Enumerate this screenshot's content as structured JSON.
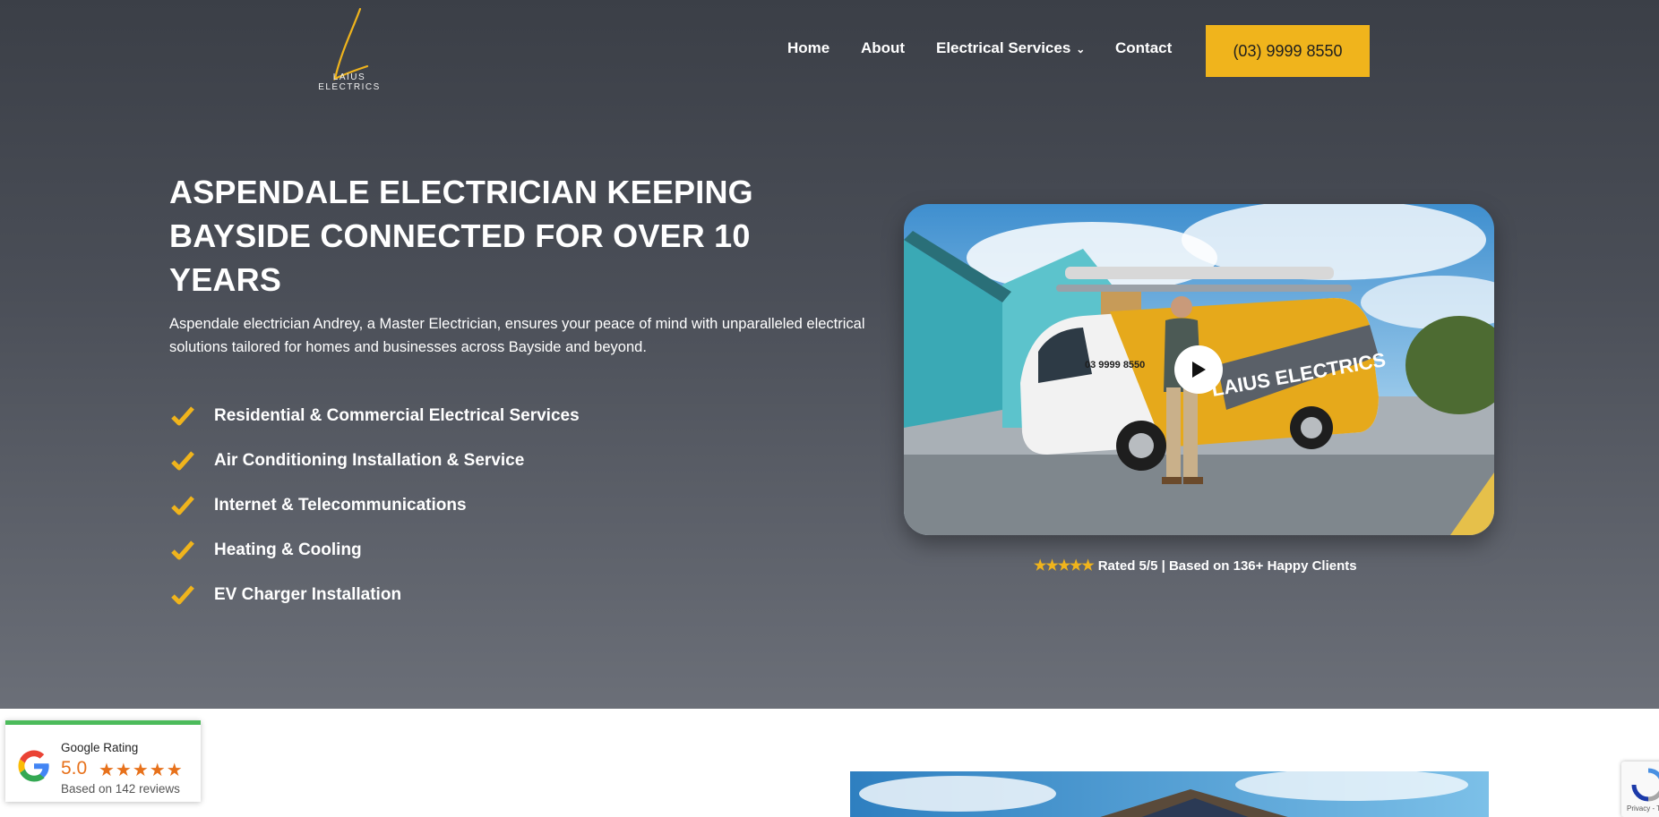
{
  "brand": {
    "logo_letter": "L",
    "name": "LAIUS ELECTRICS"
  },
  "nav": {
    "items": [
      "Home",
      "About",
      "Electrical Services",
      "Contact"
    ],
    "dropdown_item": "Electrical Services",
    "phone_button": "(03) 9999 8550"
  },
  "hero": {
    "headline": "ASPENDALE ELECTRICIAN KEEPING BAYSIDE CONNECTED FOR OVER 10 YEARS",
    "subtext": "Aspendale electrician Andrey, a Master Electrician, ensures your peace of mind with unparalleled electrical solutions tailored for homes and businesses across Bayside and beyond.",
    "services": [
      "Residential & Commercial Electrical Services",
      "Air Conditioning Installation & Service",
      "Internet & Telecommunications",
      "Heating & Cooling",
      "EV Charger Installation"
    ]
  },
  "video": {
    "van_phone": "03 9999 8550",
    "van_brand": "LAIUS ELECTRICS",
    "rating_stars": "★★★★★",
    "rating_text": "Rated 5/5 | Based on 136+ Happy Clients"
  },
  "google_badge": {
    "title": "Google Rating",
    "score": "5.0",
    "stars": "★★★★★",
    "reviews": "Based on 142 reviews"
  },
  "recaptcha": {
    "label": "Privacy - T"
  },
  "colors": {
    "accent": "#f0b41c",
    "hero_top": "#3b3f47",
    "hero_bottom": "#6b6f78",
    "google_green": "#4cbb5b",
    "google_star": "#e7711b"
  },
  "icons": {
    "checkmark": "checkmark-icon",
    "play": "play-icon",
    "chevron": "chevron-down-icon",
    "google": "google-g-icon"
  }
}
